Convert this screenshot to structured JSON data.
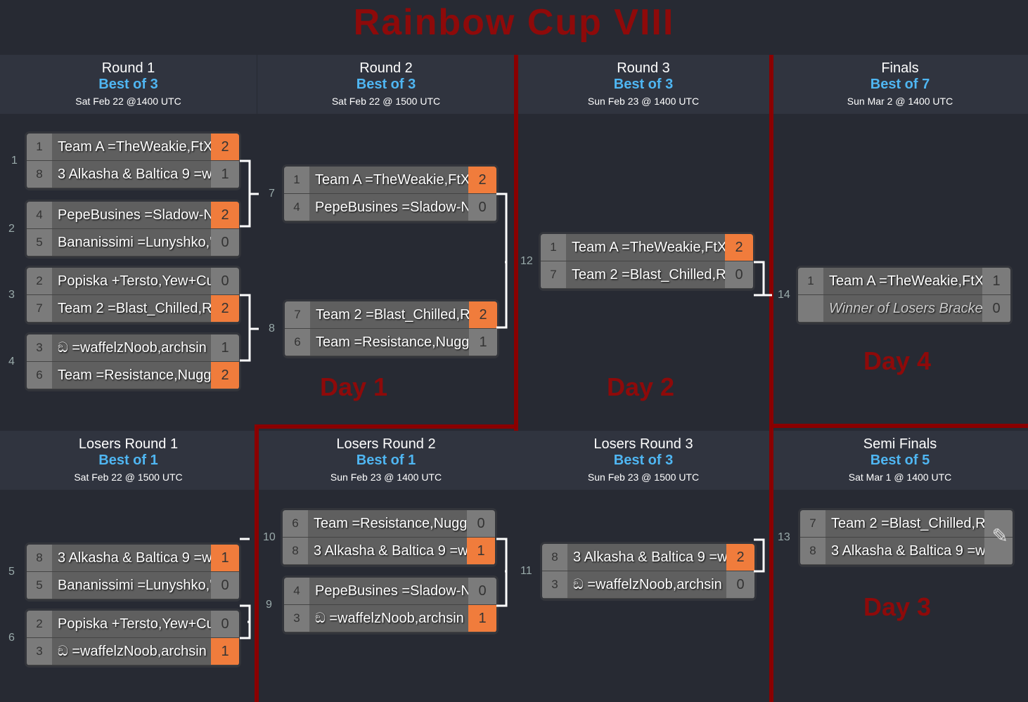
{
  "title": "Rainbow Cup VIII",
  "headers": [
    {
      "round": "Round 1",
      "best": "Best of 3",
      "date": "Sat Feb 22 @1400 UTC"
    },
    {
      "round": "Round 2",
      "best": "Best of 3",
      "date": "Sat Feb 22 @ 1500 UTC"
    },
    {
      "round": "Round 3",
      "best": "Best of 3",
      "date": "Sun Feb 23 @ 1400 UTC"
    },
    {
      "round": "Finals",
      "best": "Best of 7",
      "date": "Sun Mar 2 @ 1400 UTC"
    },
    {
      "round": "Losers Round 1",
      "best": "Best of 1",
      "date": "Sat Feb 22 @ 1500 UTC"
    },
    {
      "round": "Losers Round 2",
      "best": "Best of 1",
      "date": "Sun Feb 23 @ 1400 UTC"
    },
    {
      "round": "Losers Round 3",
      "best": "Best of 3",
      "date": "Sun Feb 23 @ 1500 UTC"
    },
    {
      "round": "Semi Finals",
      "best": "Best of 5",
      "date": "Sat Mar 1 @ 1400 UTC"
    }
  ],
  "days": [
    "Day 1",
    "Day 2",
    "Day 4",
    "Day 3"
  ],
  "colors": {
    "accent": "#4fb6f2",
    "winner": "#f07c3c",
    "red": "#8e0a0a"
  },
  "matches": [
    {
      "id": "1",
      "rows": [
        {
          "seed": "1",
          "name": "Team A =TheWeakie,FtX",
          "score": "2",
          "win": true
        },
        {
          "seed": "8",
          "name": "3 Alkasha & Baltica 9 =w",
          "score": "1"
        }
      ]
    },
    {
      "id": "2",
      "rows": [
        {
          "seed": "4",
          "name": "PepeBusines =Sladow-N",
          "score": "2",
          "win": true
        },
        {
          "seed": "5",
          "name": "Bananissimi =Lunyshko,'",
          "score": "0"
        }
      ]
    },
    {
      "id": "3",
      "rows": [
        {
          "seed": "2",
          "name": "Popiska +Tersto,Yew+Cu",
          "score": "0"
        },
        {
          "seed": "7",
          "name": "Team 2 =Blast_Chilled,Rl",
          "score": "2",
          "win": true
        }
      ]
    },
    {
      "id": "4",
      "rows": [
        {
          "seed": "3",
          "name": "ඞ =waffelzNoob,archsin",
          "score": "1"
        },
        {
          "seed": "6",
          "name": "Team =Resistance,Nugg",
          "score": "2",
          "win": true
        }
      ]
    },
    {
      "id": "7",
      "rows": [
        {
          "seed": "1",
          "name": "Team A =TheWeakie,FtX",
          "score": "2",
          "win": true
        },
        {
          "seed": "4",
          "name": "PepeBusines =Sladow-N",
          "score": "0"
        }
      ]
    },
    {
      "id": "8",
      "rows": [
        {
          "seed": "7",
          "name": "Team 2 =Blast_Chilled,Rl",
          "score": "2",
          "win": true
        },
        {
          "seed": "6",
          "name": "Team =Resistance,Nugg",
          "score": "1"
        }
      ]
    },
    {
      "id": "12",
      "rows": [
        {
          "seed": "1",
          "name": "Team A =TheWeakie,FtX",
          "score": "2",
          "win": true
        },
        {
          "seed": "7",
          "name": "Team 2 =Blast_Chilled,Rl",
          "score": "0"
        }
      ]
    },
    {
      "id": "14",
      "rows": [
        {
          "seed": "1",
          "name": "Team A =TheWeakie,FtX",
          "score": "1"
        },
        {
          "seed": "",
          "name": "Winner of Losers Bracket",
          "score": "0",
          "tbd": true
        }
      ]
    },
    {
      "id": "5",
      "rows": [
        {
          "seed": "8",
          "name": "3 Alkasha & Baltica 9 =w",
          "score": "1",
          "win": true
        },
        {
          "seed": "5",
          "name": "Bananissimi =Lunyshko,'",
          "score": "0"
        }
      ]
    },
    {
      "id": "6",
      "rows": [
        {
          "seed": "2",
          "name": "Popiska +Tersto,Yew+Cu",
          "score": "0"
        },
        {
          "seed": "3",
          "name": "ඞ =waffelzNoob,archsin",
          "score": "1",
          "win": true
        }
      ]
    },
    {
      "id": "10",
      "rows": [
        {
          "seed": "6",
          "name": "Team =Resistance,Nugg",
          "score": "0"
        },
        {
          "seed": "8",
          "name": "3 Alkasha & Baltica 9 =w",
          "score": "1",
          "win": true
        }
      ]
    },
    {
      "id": "9",
      "rows": [
        {
          "seed": "4",
          "name": "PepeBusines =Sladow-N",
          "score": "0"
        },
        {
          "seed": "3",
          "name": "ඞ =waffelzNoob,archsin",
          "score": "1",
          "win": true
        }
      ]
    },
    {
      "id": "11",
      "rows": [
        {
          "seed": "8",
          "name": "3 Alkasha & Baltica 9 =w",
          "score": "2",
          "win": true
        },
        {
          "seed": "3",
          "name": "ඞ =waffelzNoob,archsin",
          "score": "0"
        }
      ]
    },
    {
      "id": "13",
      "rows": [
        {
          "seed": "7",
          "name": "Team 2 =Blast_Chilled,Rl",
          "score": ""
        },
        {
          "seed": "8",
          "name": "3 Alkasha & Baltica 9 =w",
          "score": ""
        }
      ],
      "edit_icon": "edit-icon"
    }
  ]
}
